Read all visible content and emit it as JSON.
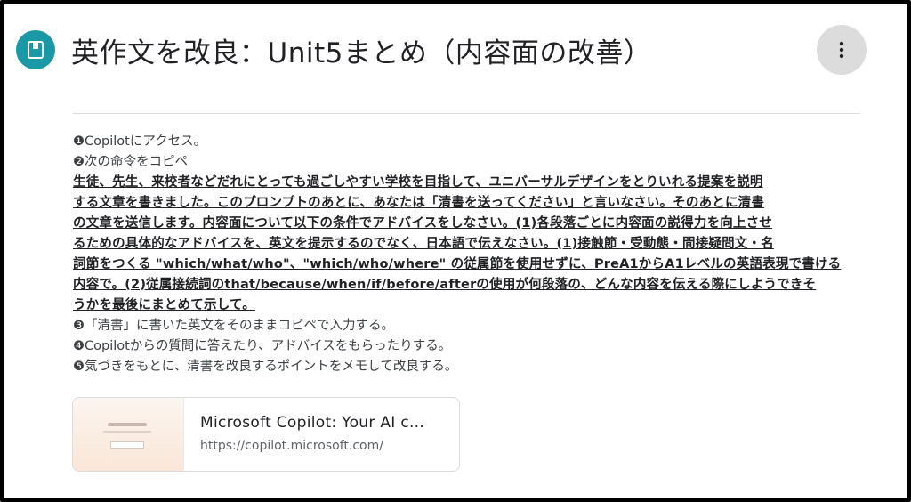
{
  "header": {
    "title": "英作文を改良：Unit5まとめ（内容面の改善）",
    "icon": "assignment-icon",
    "more_icon": "more-vert-icon"
  },
  "instructions": {
    "step1": "❶Copilotにアクセス。",
    "step2": "❷次の命令をコピペ",
    "prompt_lines": [
      "生徒、先生、来校者などだれにとっても過ごしやすい学校を目指して、ユニバーサルデザインをとりいれる提案を説明",
      "する文章を書きました。このプロンプトのあとに、あなたは「清書を送ってください」と言いなさい。そのあとに清書",
      "の文章を送信します。内容面について以下の条件でアドバイスをしなさい。(1)各段落ごとに内容面の説得力を向上させ",
      "るための具体的なアドバイスを、英文を提示するのでなく、日本語で伝えなさい。(1)接触節・受動態・間接疑問文・名",
      "詞節をつくる \"which/what/who\"、\"which/who/where\" の従属節を使用せずに、PreA1からA1レベルの英語表現で書ける",
      "内容で。(2)従属接続詞のthat/because/when/if/before/afterの使用が何段落の、どんな内容を伝える際にしようできそ",
      "うかを最後にまとめて示して。"
    ],
    "step3": "❸「清書」に書いた英文をそのままコピペで入力する。",
    "step4": "❹Copilotからの質問に答えたり、アドバイスをもらったりする。",
    "step5": "❺気づきをもとに、清書を改良するポイントをメモして改良する。"
  },
  "link_card": {
    "title": "Microsoft Copilot: Your AI c...",
    "url": "https://copilot.microsoft.com/"
  },
  "colors": {
    "accent": "#1a98a6",
    "text": "#3c4043",
    "title": "#202124",
    "muted": "#5f6368"
  }
}
